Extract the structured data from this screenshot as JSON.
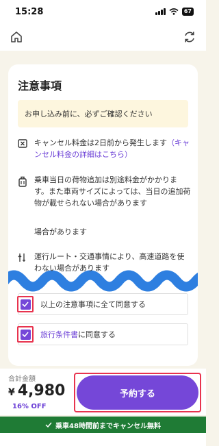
{
  "status_bar": {
    "time": "15:28",
    "battery": "67"
  },
  "card": {
    "title": "注意事項",
    "notice": "お申し込み前に、必ずご確認ください",
    "cancel_fee_text": "キャンセル料金は2日前から発生します",
    "cancel_fee_link": "キャンセル料金の詳細はこちら",
    "baggage_text_1": "乗車当日の荷物追加は別途料金がかかります。また車両サイズによっては、当日の追加荷物が載せられない場合があります",
    "baggage_text_2": "場合があります",
    "route_text": "運行ルート・交通事情により、高速道路を使わない場合があります",
    "agree_all_label": "以上の注意事項に全て同意する",
    "travel_terms_link": "旅行条件書",
    "travel_terms_suffix": "に同意する"
  },
  "footer": {
    "total_label": "合計金額",
    "currency": "¥",
    "amount": "4,980",
    "discount": "16% OFF",
    "reserve_label": "予約する"
  },
  "banner": {
    "text": "乗車48時間前までキャンセル無料"
  },
  "colors": {
    "accent": "#7547d8",
    "highlight": "#e8334e",
    "banner": "#1f7b35",
    "wave": "#2e7fe0"
  }
}
